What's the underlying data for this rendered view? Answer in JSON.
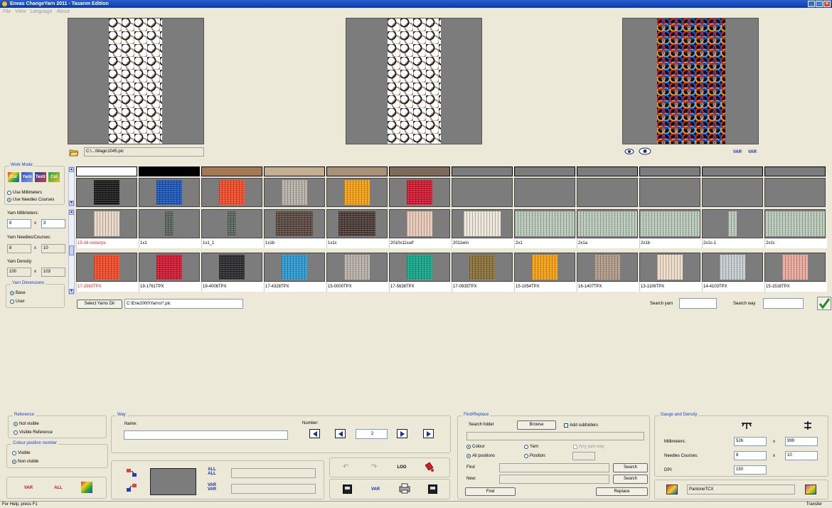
{
  "window": {
    "title": "Eneas ChangeYarn 2011 - Tasarım Edition",
    "controls": [
      "_",
      "□",
      "×"
    ]
  },
  "menu": [
    "File",
    "View",
    "Language",
    "About"
  ],
  "preview": {
    "file_path": "C:\\...\\Magic1045.pic"
  },
  "work_mode": {
    "title": "Work Mode:",
    "mode_buttons": [
      "Col",
      "Yarn",
      "Textr",
      "Col"
    ],
    "options": [
      {
        "label": "Use Millimeters",
        "selected": false
      },
      {
        "label": "Use Needles Courses",
        "selected": true
      }
    ],
    "yarn_mm_label": "Yarn Millimeters:",
    "yarn_mm": [
      "8",
      "3"
    ],
    "yarn_nc_label": "Yarn Needles/Courses:",
    "yarn_nc": [
      "8",
      "10"
    ],
    "yarn_density_label": "Yarn Density:",
    "yarn_density": [
      "100",
      "103"
    ],
    "x": "x",
    "dims_title": "Yarn Dimensions",
    "dims": [
      {
        "label": "Base",
        "selected": true
      },
      {
        "label": "User",
        "selected": false
      }
    ]
  },
  "colors": {
    "cells": [
      "#ffffff",
      "#000000",
      "#a47852",
      "#c4ae92",
      "#a89176",
      "#7e6a58",
      "#7c7c7c",
      "#7c7c7c",
      "#7c7c7c",
      "#7c7c7c",
      "#7c7c7c",
      "#7c7c7c"
    ],
    "swatches": [
      "#1a1a1a",
      "#1b55b8",
      "#f04a26",
      "#b8b0a8",
      "#f4a010",
      "#d01830",
      null,
      null,
      null,
      null,
      null,
      null
    ]
  },
  "yarns_row1": [
    {
      "label": "15-16 colourpx",
      "color": "#e8d6c6",
      "kind": "normal",
      "highlight": true
    },
    {
      "label": "1x1",
      "color": "#58635a",
      "kind": "narrow",
      "highlight": false
    },
    {
      "label": "1x1_1",
      "color": "#58635a",
      "kind": "narrow",
      "highlight": false
    },
    {
      "label": "1x1b",
      "color": "#5a4840",
      "kind": "wide2",
      "highlight": false
    },
    {
      "label": "1x1c",
      "color": "#4a3a36",
      "kind": "wide2",
      "highlight": false
    },
    {
      "label": "2010x11surf",
      "color": "#e8c8b8",
      "kind": "normal",
      "highlight": false
    },
    {
      "label": "2011win",
      "color": "#ece6d8",
      "kind": "wide2",
      "highlight": false
    },
    {
      "label": "2x1",
      "color": "#b8c8b8",
      "kind": "wide",
      "highlight": false
    },
    {
      "label": "2x1a",
      "color": "#b8c8b8",
      "kind": "wide",
      "highlight": false
    },
    {
      "label": "2x1b",
      "color": "#b8c8b8",
      "kind": "wide",
      "highlight": false
    },
    {
      "label": "2x1c-1",
      "color": "#b8c8b8",
      "kind": "narrow",
      "highlight": false
    },
    {
      "label": "2x1c",
      "color": "#b8c8b8",
      "kind": "wide",
      "highlight": false
    }
  ],
  "yarns_row2": [
    {
      "label": "17-1563TPX",
      "color": "#f04a26",
      "highlight": true
    },
    {
      "label": "19-1761TPX",
      "color": "#d01830",
      "highlight": false
    },
    {
      "label": "19-4006TPX",
      "color": "#2a2a2e",
      "highlight": false
    },
    {
      "label": "17-4328TPX",
      "color": "#2a9ad0",
      "highlight": false
    },
    {
      "label": "15-0000TPX",
      "color": "#b8b0a8",
      "highlight": false
    },
    {
      "label": "17-5638TPX",
      "color": "#10a888",
      "highlight": false
    },
    {
      "label": "17-0935TPX",
      "color": "#8a7038",
      "highlight": false
    },
    {
      "label": "15-1054TPX",
      "color": "#f4a010",
      "highlight": false
    },
    {
      "label": "16-1407TPX",
      "color": "#b09a88",
      "highlight": false
    },
    {
      "label": "13-1106TPX",
      "color": "#eedcc8",
      "highlight": false
    },
    {
      "label": "14-4103TPX",
      "color": "#c6ccd0",
      "highlight": false
    },
    {
      "label": "15-1516TPX",
      "color": "#e8a89c",
      "highlight": false
    }
  ],
  "yarn_dir": {
    "button": "Select Yarns Dir",
    "path": "C:\\Ene2000\\Yarns\\*.pic",
    "search_yarn_label": "Search yarn",
    "search_way_label": "Search way"
  },
  "reference": {
    "title": "Reference:",
    "options": [
      {
        "label": "Not visible",
        "selected": true
      },
      {
        "label": "Visible Reference",
        "selected": false
      }
    ]
  },
  "colour_position": {
    "title": "Colour position number",
    "options": [
      {
        "label": "Visible",
        "selected": false
      },
      {
        "label": "Non visible",
        "selected": true
      }
    ]
  },
  "bottom_left_icons": [
    "VAR",
    "ALL"
  ],
  "way": {
    "title": "Way",
    "name_label": "Name:",
    "number_label": "Number:",
    "number_value": "2",
    "all_all": [
      "ALL",
      "ALL"
    ],
    "var_var": [
      "VAR",
      "VAR"
    ],
    "log": "LOG",
    "var": "VAR"
  },
  "find_replace": {
    "title": "Find/Replace",
    "search_folder_label": "Search folder",
    "browse": "Browse",
    "add_subfolders": "Add subfolders",
    "options": [
      {
        "label": "Colour",
        "selected": true
      },
      {
        "label": "Yarn",
        "selected": false
      }
    ],
    "positions": [
      {
        "label": "All positions",
        "selected": true
      },
      {
        "label": "Position:",
        "selected": false
      }
    ],
    "any_yarn_way": "Any yarn way",
    "find_label": "Find",
    "new_label": "New:",
    "search": "Search",
    "find_btn": "Find",
    "replace_btn": "Replace"
  },
  "gauge": {
    "title": "Gauge and Density",
    "mm_label": "Millimeters:",
    "mm": [
      "526",
      "999"
    ],
    "nc_label": "Needles Courses:",
    "nc": [
      "8",
      "10"
    ],
    "dpi_label": "DPI:",
    "dpi": "150",
    "palette": "PantoneTCX"
  },
  "status": {
    "left": "For Help, press F1",
    "right": "Transfer"
  }
}
